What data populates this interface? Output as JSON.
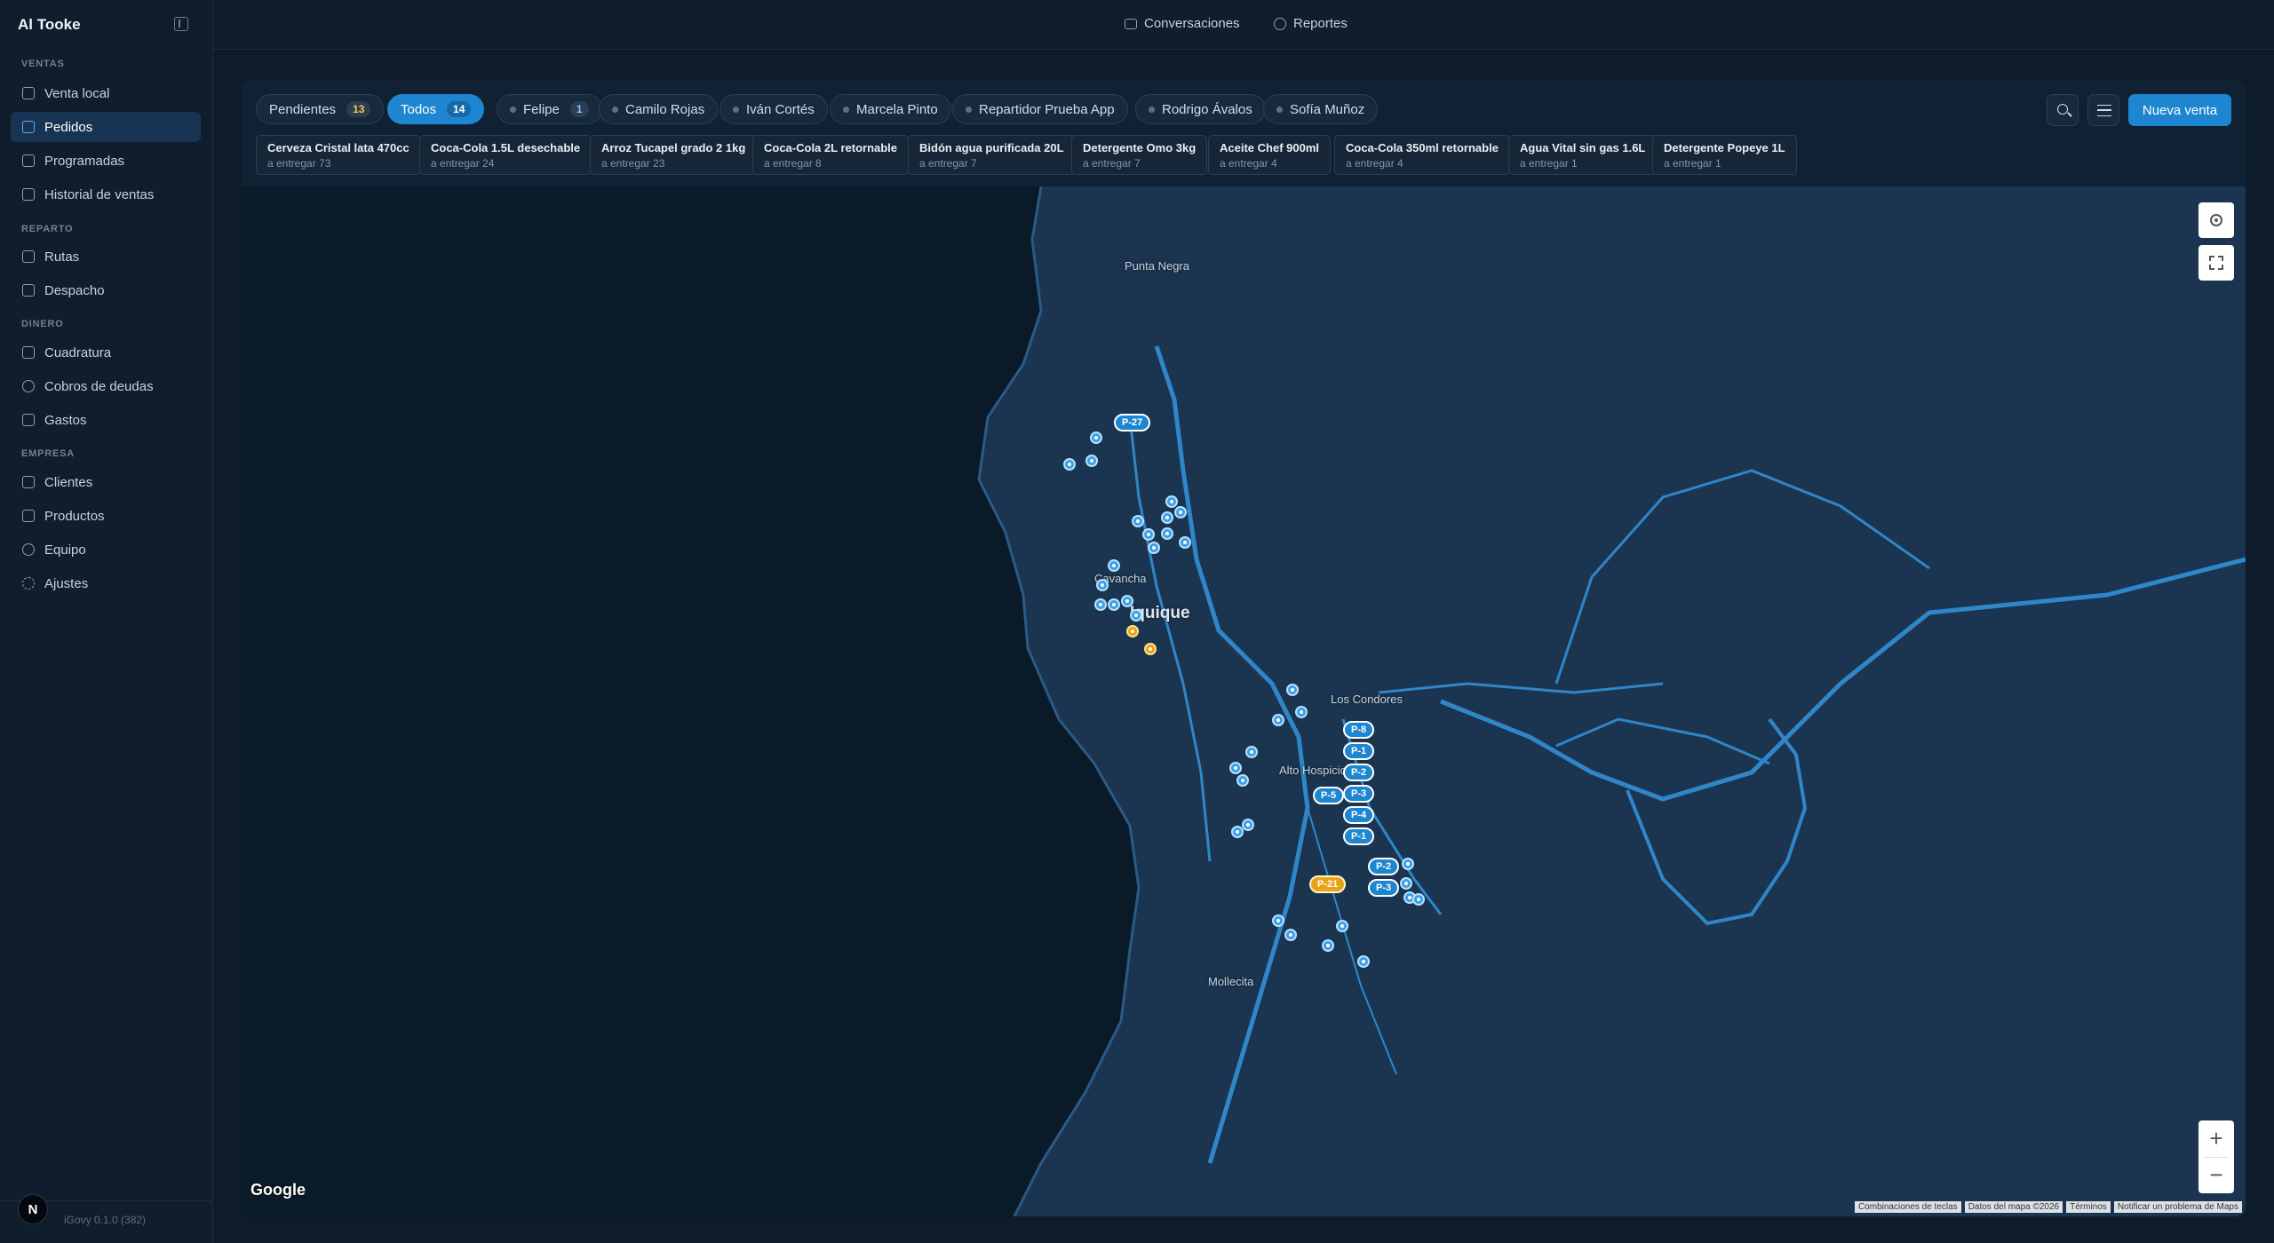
{
  "app": {
    "title": "Al Tooke",
    "version": "iGovy 0.1.0 (382)",
    "avatar_letter": "N"
  },
  "sidebar": {
    "sections": [
      {
        "title": "VENTAS",
        "items": [
          {
            "label": "Venta local",
            "icon": "store-icon"
          },
          {
            "label": "Pedidos",
            "icon": "clipboard-icon",
            "active": true
          },
          {
            "label": "Programadas",
            "icon": "calendar-icon"
          },
          {
            "label": "Historial de ventas",
            "icon": "receipt-icon"
          }
        ]
      },
      {
        "title": "REPARTO",
        "items": [
          {
            "label": "Rutas",
            "icon": "truck-icon"
          },
          {
            "label": "Despacho",
            "icon": "warehouse-icon"
          }
        ]
      },
      {
        "title": "DINERO",
        "items": [
          {
            "label": "Cuadratura",
            "icon": "banknote-icon"
          },
          {
            "label": "Cobros de deudas",
            "icon": "hand-coins-icon"
          },
          {
            "label": "Gastos",
            "icon": "wallet-icon"
          }
        ]
      },
      {
        "title": "EMPRESA",
        "items": [
          {
            "label": "Clientes",
            "icon": "building-icon"
          },
          {
            "label": "Productos",
            "icon": "package-icon"
          },
          {
            "label": "Equipo",
            "icon": "users-icon"
          },
          {
            "label": "Ajustes",
            "icon": "gear-icon"
          }
        ]
      }
    ]
  },
  "topbar": {
    "conversations": "Conversaciones",
    "reports": "Reportes"
  },
  "filters": {
    "pending": {
      "label": "Pendientes",
      "count": "13"
    },
    "all": {
      "label": "Todos",
      "count": "14"
    },
    "drivers": [
      {
        "label": "Felipe",
        "count": "1"
      },
      {
        "label": "Camilo Rojas"
      },
      {
        "label": "Iván Cortés"
      },
      {
        "label": "Marcela Pinto"
      },
      {
        "label": "Repartidor Prueba App"
      },
      {
        "label": "Rodrigo Ávalos"
      },
      {
        "label": "Sofía Muñoz"
      }
    ]
  },
  "actions": {
    "new_sale": "Nueva venta"
  },
  "products": [
    {
      "name": "Cerveza Cristal lata 470cc",
      "pending": "a entregar 73"
    },
    {
      "name": "Coca-Cola 1.5L desechable",
      "pending": "a entregar 24"
    },
    {
      "name": "Arroz Tucapel grado 2 1kg",
      "pending": "a entregar 23"
    },
    {
      "name": "Coca-Cola 2L retornable",
      "pending": "a entregar 8"
    },
    {
      "name": "Bidón agua purificada 20L",
      "pending": "a entregar 7"
    },
    {
      "name": "Detergente Omo 3kg",
      "pending": "a entregar 7"
    },
    {
      "name": "Aceite Chef 900ml",
      "pending": "a entregar 4"
    },
    {
      "name": "Coca-Cola 350ml retornable",
      "pending": "a entregar 4"
    },
    {
      "name": "Agua Vital sin gas 1.6L",
      "pending": "a entregar 1"
    },
    {
      "name": "Detergente Popeye 1L",
      "pending": "a entregar 1"
    }
  ],
  "map": {
    "labels": {
      "punta_negra": "Punta Negra",
      "iquique": "Iquique",
      "cavancha": "Cavancha",
      "los_condores": "Los Condores",
      "alto_hospicio": "Alto Hospicio",
      "mollecita": "Mollecita"
    },
    "markers": [
      "P-27",
      "P-8",
      "P-1",
      "P-2",
      "P-5",
      "P-3",
      "P-4",
      "P-1",
      "P-2",
      "P-3",
      "P-21"
    ],
    "google": "Google",
    "attribution": [
      "Combinaciones de teclas",
      "Datos del mapa ©2026",
      "Términos",
      "Notificar un problema de Maps"
    ],
    "colors": {
      "road": "#2f86c9",
      "land": "#1b3550",
      "sea": "#0b1a28"
    }
  }
}
